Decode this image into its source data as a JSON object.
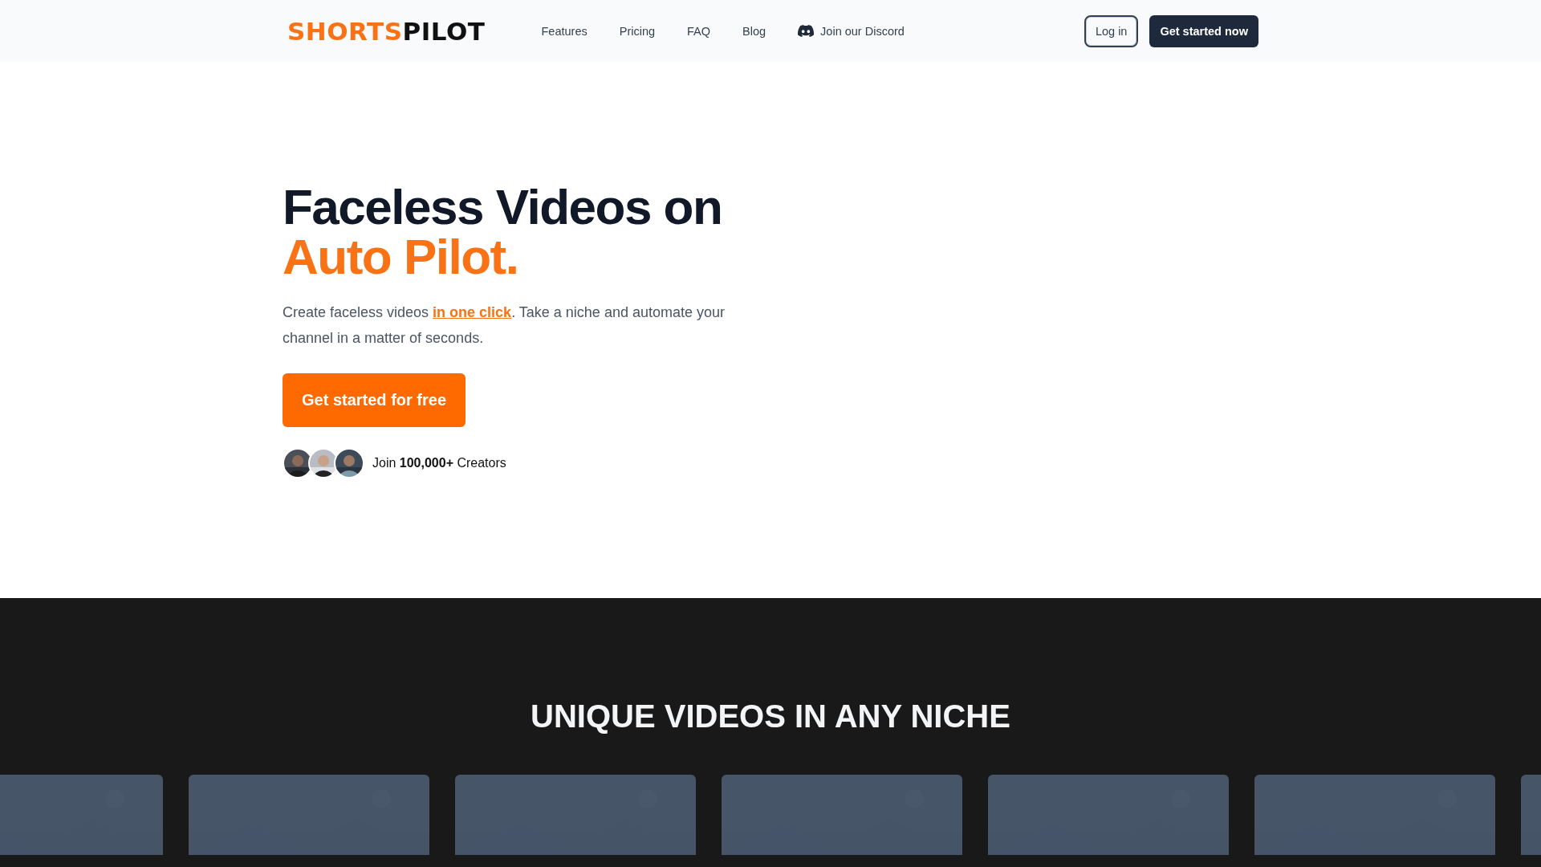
{
  "logo": {
    "first": "SHORTS",
    "second": "PILOT"
  },
  "nav": {
    "links": [
      "Features",
      "Pricing",
      "FAQ",
      "Blog"
    ],
    "discord": "Join our Discord",
    "login": "Log in",
    "cta": "Get started now"
  },
  "hero": {
    "title": "Faceless Videos on",
    "accent": "Auto Pilot.",
    "text_before": "Create faceless videos ",
    "link": "in one click",
    "text_after": ". Take a niche and automate your channel in a matter of seconds.",
    "button": "Get started for free",
    "social_proof": "Join **100,000+** Creators"
  },
  "niches": {
    "title": "UNIQUE VIDEOS IN ANY NICHE"
  }
}
